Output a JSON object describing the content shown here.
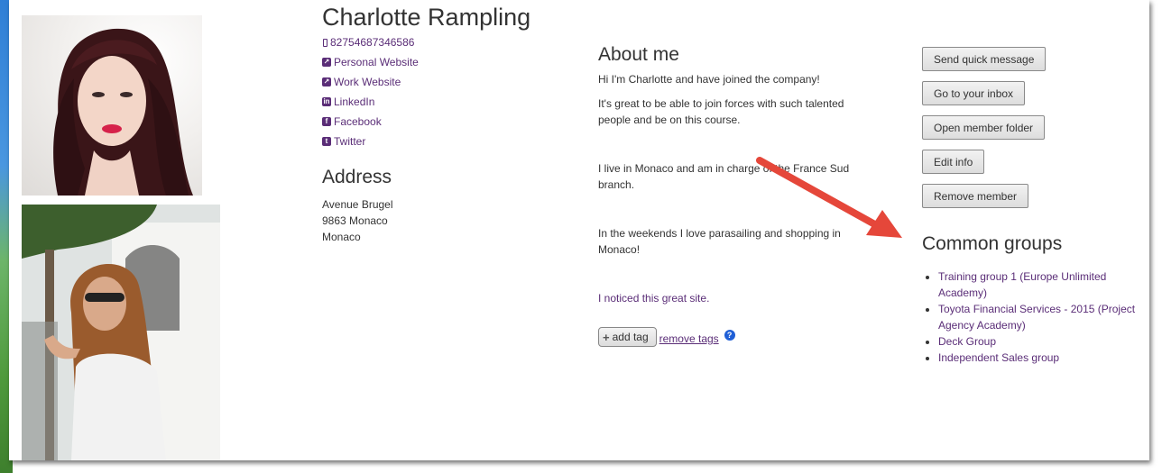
{
  "profile": {
    "name": "Charlotte Rampling",
    "phone": "82754687346586",
    "links": [
      {
        "label": "Personal Website",
        "icon": "external-link-icon"
      },
      {
        "label": "Work Website",
        "icon": "external-link-icon"
      },
      {
        "label": "LinkedIn",
        "icon": "linkedin-icon"
      },
      {
        "label": "Facebook",
        "icon": "facebook-icon"
      },
      {
        "label": "Twitter",
        "icon": "twitter-icon"
      }
    ]
  },
  "address": {
    "title": "Address",
    "lines": [
      "Avenue Brugel",
      "9863 Monaco",
      "Monaco"
    ]
  },
  "about": {
    "title": "About me",
    "paragraphs": [
      "Hi I'm Charlotte and have joined the company!",
      "It's great to be able to join forces with such talented people and be on this course.",
      "I live in Monaco and am in charge of the France Sud branch.",
      "In the weekends I love parasailing and shopping in Monaco!",
      "I noticed this great site."
    ]
  },
  "tags": {
    "add_label": "add tag",
    "remove_label": "remove tags",
    "help_glyph": "?"
  },
  "actions": {
    "send_quick_message": "Send quick message",
    "inbox": "Go to your inbox",
    "open_folder": "Open member folder",
    "edit_info": "Edit info",
    "remove_member": "Remove member"
  },
  "groups": {
    "title": "Common groups",
    "items": [
      "Training group 1 (Europe Unlimited Academy)",
      "Toyota Financial Services - 2015 (Project Agency Academy)",
      "Deck Group",
      "Independent Sales group"
    ]
  },
  "colors": {
    "link": "#5a2d77",
    "arrow": "#e5473a",
    "help_badge": "#1f5fd6"
  }
}
